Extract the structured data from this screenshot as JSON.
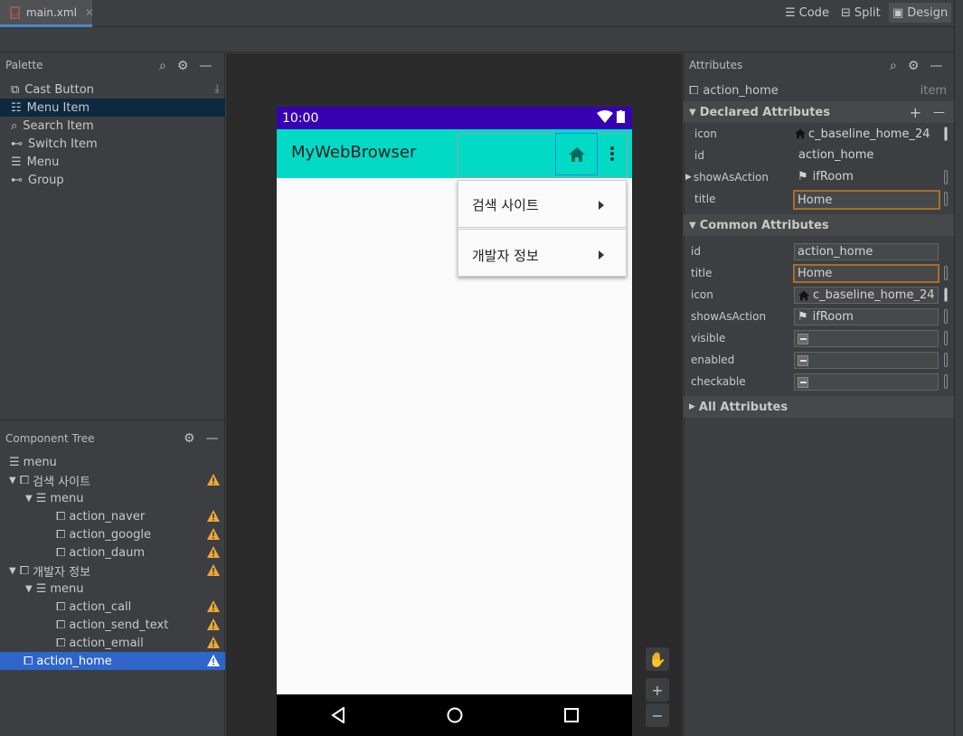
{
  "tab": {
    "filename": "main.xml"
  },
  "modes": {
    "code": "Code",
    "split": "Split",
    "design": "Design"
  },
  "palette": {
    "title": "Palette",
    "items": [
      {
        "label": "Cast Button",
        "icon": "cast-icon"
      },
      {
        "label": "Menu Item",
        "icon": "list-icon"
      },
      {
        "label": "Search Item",
        "icon": "search-icon"
      },
      {
        "label": "Switch Item",
        "icon": "switch-icon"
      },
      {
        "label": "Menu",
        "icon": "menu-icon"
      },
      {
        "label": "Group",
        "icon": "group-icon"
      }
    ]
  },
  "tree": {
    "title": "Component Tree",
    "rows": [
      {
        "label": "menu"
      },
      {
        "label": "검색 사이트"
      },
      {
        "label": "menu"
      },
      {
        "label": "action_naver"
      },
      {
        "label": "action_google"
      },
      {
        "label": "action_daum"
      },
      {
        "label": "개발자 정보"
      },
      {
        "label": "menu"
      },
      {
        "label": "action_call"
      },
      {
        "label": "action_send_text"
      },
      {
        "label": "action_email"
      },
      {
        "label": "action_home"
      }
    ]
  },
  "phone": {
    "time": "10:00",
    "app_title": "MyWebBrowser",
    "dropdown": [
      "검색 사이트",
      "개발자 정보"
    ]
  },
  "attributes": {
    "title": "Attributes",
    "component": "action_home",
    "component_type": "item",
    "declared_title": "Declared Attributes",
    "declared": {
      "icon_label": "icon",
      "icon_value": "c_baseline_home_24",
      "id_label": "id",
      "id_value": "action_home",
      "show_label": "showAsAction",
      "show_value": "ifRoom",
      "title_label": "title",
      "title_value": "Home"
    },
    "common_title": "Common Attributes",
    "common": {
      "id_label": "id",
      "id_value": "action_home",
      "title_label": "title",
      "title_value": "Home",
      "icon_label": "icon",
      "icon_value": "c_baseline_home_24",
      "show_label": "showAsAction",
      "show_value": "ifRoom",
      "visible_label": "visible",
      "enabled_label": "enabled",
      "checkable_label": "checkable"
    },
    "all_title": "All Attributes"
  },
  "colors": {
    "accent": "#2f65ca",
    "statusbar": "#3700b3",
    "appbar": "#03dac5",
    "warning": "#f0a732"
  }
}
